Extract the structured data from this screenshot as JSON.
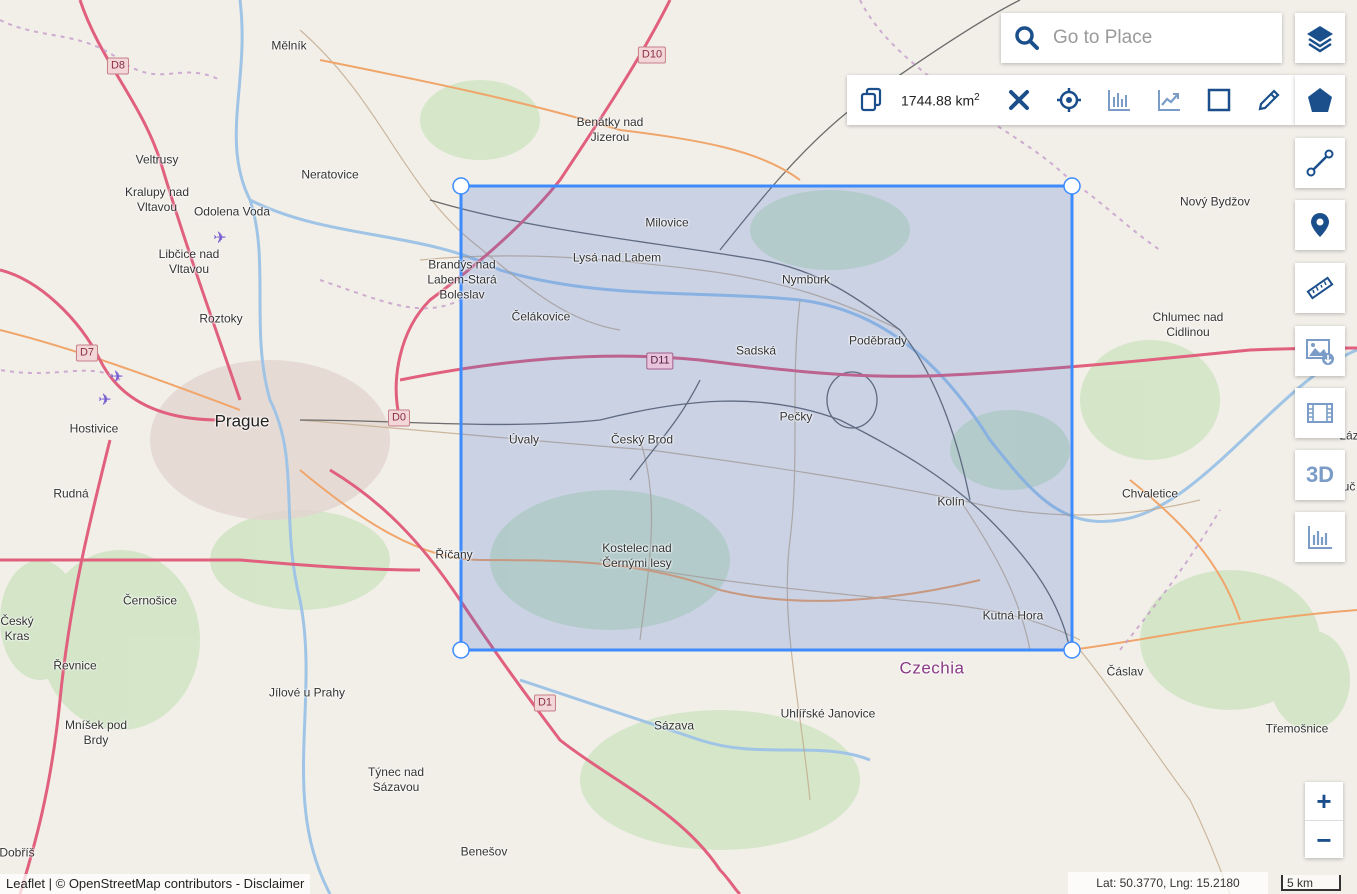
{
  "map": {
    "places": [
      {
        "name": "Mělník",
        "kind": "town"
      },
      {
        "name": "Benátky nad\nJizerou",
        "kind": "town"
      },
      {
        "name": "Veltrusy",
        "kind": "town"
      },
      {
        "name": "Neratovice",
        "kind": "town"
      },
      {
        "name": "Kralupy nad\nVltavou",
        "kind": "town"
      },
      {
        "name": "Odolena Voda",
        "kind": "town"
      },
      {
        "name": "Libčice nad\nVltavou",
        "kind": "town"
      },
      {
        "name": "Milovice",
        "kind": "town"
      },
      {
        "name": "Lysá nad Labem",
        "kind": "town"
      },
      {
        "name": "Brandýs nad\nLabem-Stará\nBoleslav",
        "kind": "town"
      },
      {
        "name": "Nymburk",
        "kind": "town"
      },
      {
        "name": "Nový Bydžov",
        "kind": "town"
      },
      {
        "name": "Roztoky",
        "kind": "town"
      },
      {
        "name": "Čelákovice",
        "kind": "town"
      },
      {
        "name": "Poděbrady",
        "kind": "town"
      },
      {
        "name": "Chlumec nad\nCidlinou",
        "kind": "town"
      },
      {
        "name": "Sadská",
        "kind": "town"
      },
      {
        "name": "Prague",
        "kind": "city"
      },
      {
        "name": "Hostivice",
        "kind": "town"
      },
      {
        "name": "Pečky",
        "kind": "town"
      },
      {
        "name": "Úvaly",
        "kind": "town"
      },
      {
        "name": "Český Brod",
        "kind": "town"
      },
      {
        "name": "Rudná",
        "kind": "town"
      },
      {
        "name": "Kolín",
        "kind": "town"
      },
      {
        "name": "Chvaletice",
        "kind": "town"
      },
      {
        "name": "Přelouč",
        "kind": "town"
      },
      {
        "name": "Říčany",
        "kind": "town"
      },
      {
        "name": "Kostelec nad\nČernými lesy",
        "kind": "town"
      },
      {
        "name": "Černošice",
        "kind": "town"
      },
      {
        "name": "Kutná Hora",
        "kind": "town"
      },
      {
        "name": "Czechia",
        "kind": "country"
      },
      {
        "name": "Čáslav",
        "kind": "town"
      },
      {
        "name": "Řevnice",
        "kind": "town"
      },
      {
        "name": "Jílové u Prahy",
        "kind": "town"
      },
      {
        "name": "Uhlířské Janovice",
        "kind": "town"
      },
      {
        "name": "Sázava",
        "kind": "town"
      },
      {
        "name": "Mníšek pod\nBrdy",
        "kind": "town"
      },
      {
        "name": "Třemošnice",
        "kind": "town"
      },
      {
        "name": "Týnec nad\nSázavou",
        "kind": "town"
      },
      {
        "name": "Benešov",
        "kind": "town"
      },
      {
        "name": "Dobříš",
        "kind": "town"
      },
      {
        "name": "Český\nKras",
        "kind": "town"
      },
      {
        "name": "Láz",
        "kind": "town"
      }
    ],
    "road_shields": [
      {
        "label": "D8",
        "kind": "trunk"
      },
      {
        "label": "D10",
        "kind": "trunk"
      },
      {
        "label": "D7",
        "kind": "trunk"
      },
      {
        "label": "D11",
        "kind": "motorway"
      },
      {
        "label": "D0",
        "kind": "trunk"
      },
      {
        "label": "D1",
        "kind": "trunk"
      }
    ],
    "selection": {
      "shape": "rectangle",
      "stroke": "#3d8bfd",
      "fill": "#3d6fd1"
    }
  },
  "search": {
    "placeholder": "Go to Place"
  },
  "draw_toolbar": {
    "area_value": "1744.88 km",
    "area_unit_sup": "2",
    "tools": [
      "copy-icon",
      "delete-icon",
      "locate-icon",
      "histogram-icon",
      "trend-icon",
      "rectangle-icon",
      "edit-icon"
    ]
  },
  "side_controls": [
    "layers-icon",
    "polygon-icon",
    "line-icon",
    "marker-icon",
    "ruler-icon",
    "image-download-icon",
    "film-icon",
    "3D",
    "chart-icon"
  ],
  "zoom": {
    "in": "+",
    "out": "−"
  },
  "attribution": "Leaflet | © OpenStreetMap contributors - Disclaimer",
  "coords": "Lat: 50.3770, Lng: 15.2180",
  "scale": "5 km",
  "colors": {
    "accent": "#1a4f8b",
    "selection": "#3d8bfd"
  }
}
